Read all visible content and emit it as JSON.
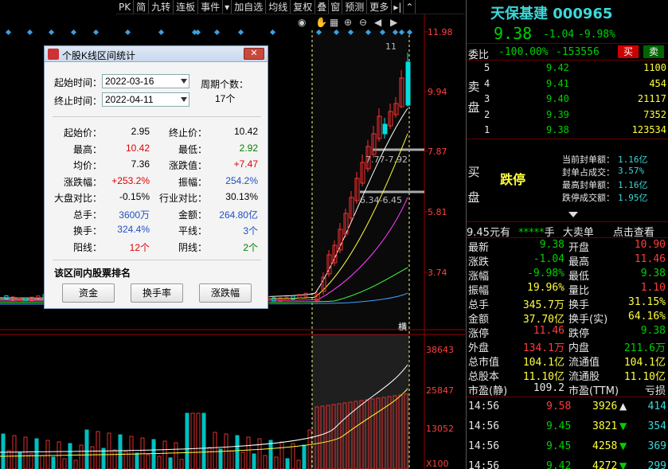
{
  "toolbar": {
    "items": [
      "PK",
      "简",
      "九转",
      "连板",
      "事件",
      "▾",
      "加自选",
      "均线",
      "复权",
      "叠",
      "窗",
      "预测",
      "更多",
      "▸|",
      "⌃"
    ]
  },
  "chart": {
    "price_axis": [
      "11.98",
      "9.94",
      "7.87",
      "5.81",
      "3.74"
    ],
    "volume_axis": [
      "38643",
      "25847",
      "13052",
      "X100"
    ],
    "annotations": [
      "11",
      "7.77-7.92",
      "6.34-6.45"
    ],
    "range_marker": "横"
  },
  "dialog": {
    "title": "个股K线区间统计",
    "start_label": "起始时间：",
    "start_value": "2022-03-16",
    "end_label": "终止时间：",
    "end_value": "2022-04-11",
    "period_label": "周期个数：",
    "period_value": "17个",
    "stats": [
      {
        "l1": "起始价：",
        "v1": "2.95",
        "c1": "",
        "l2": "终止价：",
        "v2": "10.42",
        "c2": ""
      },
      {
        "l1": "最高：",
        "v1": "10.42",
        "c1": "red",
        "l2": "最低：",
        "v2": "2.92",
        "c2": "green"
      },
      {
        "l1": "均价：",
        "v1": "7.36",
        "c1": "",
        "l2": "涨跌值：",
        "v2": "+7.47",
        "c2": "red"
      },
      {
        "l1": "涨跌幅：",
        "v1": "+253.2%",
        "c1": "red",
        "l2": "振幅：",
        "v2": "254.2%",
        "c2": "blue"
      },
      {
        "l1": "大盘对比：",
        "v1": "-0.15%",
        "c1": "",
        "l2": "行业对比：",
        "v2": "30.13%",
        "c2": ""
      },
      {
        "l1": "总手：",
        "v1": "3600万",
        "c1": "blue",
        "l2": "金额：",
        "v2": "264.80亿",
        "c2": "blue"
      },
      {
        "l1": "换手：",
        "v1": "324.4%",
        "c1": "blue",
        "l2": "平线：",
        "v2": "3个",
        "c2": "blue"
      },
      {
        "l1": "阳线：",
        "v1": "12个",
        "c1": "red",
        "l2": "阴线：",
        "v2": "2个",
        "c2": "green"
      }
    ],
    "rank_label": "该区间内股票排名",
    "buttons": [
      "资金",
      "换手率",
      "涨跌幅"
    ]
  },
  "quote": {
    "name_code": "天保基建 000965",
    "price": "9.38",
    "change": "-1.04",
    "pct": "-9.98%",
    "weibi_label": "委比",
    "weibi_pct": "-100.00%",
    "weibi_diff": "-153556",
    "buy_btn": "买",
    "sell_btn": "卖",
    "sell_label": "卖盘",
    "sells": [
      {
        "lv": "5",
        "p": "9.42",
        "v": "1100"
      },
      {
        "lv": "4",
        "p": "9.41",
        "v": "454"
      },
      {
        "lv": "3",
        "p": "9.40",
        "v": "21117"
      },
      {
        "lv": "2",
        "p": "9.39",
        "v": "7352"
      },
      {
        "lv": "1",
        "p": "9.38",
        "v": "123534"
      }
    ],
    "buy_label": "买盘",
    "limit_text": "跌停",
    "seal_rows": [
      {
        "k": "当前封单额：",
        "v": "1.16亿"
      },
      {
        "k": "封单占成交：",
        "v": "3.57%"
      },
      {
        "k": "最高封单额：",
        "v": "1.16亿"
      },
      {
        "k": "跌停成交额：",
        "v": "1.95亿"
      }
    ],
    "bar_price": "9.45",
    "bar_unit": "元有",
    "bar_stars": "*****",
    "bar_hand": "手",
    "bar_big": "大卖单",
    "bar_click": "点击查看",
    "details": [
      {
        "k1": "最新",
        "v1": "9.38",
        "c1": "G",
        "k2": "开盘",
        "v2": "10.90",
        "c2": "R"
      },
      {
        "k1": "涨跌",
        "v1": "-1.04",
        "c1": "G",
        "k2": "最高",
        "v2": "11.46",
        "c2": "R"
      },
      {
        "k1": "涨幅",
        "v1": "-9.98%",
        "c1": "G",
        "k2": "最低",
        "v2": "9.38",
        "c2": "G"
      },
      {
        "k1": "振幅",
        "v1": "19.96%",
        "c1": "Y",
        "k2": "量比",
        "v2": "1.10",
        "c2": "R"
      },
      {
        "k1": "总手",
        "v1": "345.7万",
        "c1": "Y",
        "k2": "换手",
        "v2": "31.15%",
        "c2": "Y"
      },
      {
        "k1": "金额",
        "v1": "37.70亿",
        "c1": "Y",
        "k2": "换手(实)",
        "v2": "64.16%",
        "c2": "Y"
      },
      {
        "k1": "涨停",
        "v1": "11.46",
        "c1": "R",
        "k2": "跌停",
        "v2": "9.38",
        "c2": "G"
      },
      {
        "k1": "外盘",
        "v1": "134.1万",
        "c1": "R",
        "k2": "内盘",
        "v2": "211.6万",
        "c2": "G"
      },
      {
        "k1": "总市值",
        "v1": "104.1亿",
        "c1": "Y",
        "k2": "流通值",
        "v2": "104.1亿",
        "c2": "Y"
      },
      {
        "k1": "总股本",
        "v1": "11.10亿",
        "c1": "Y",
        "k2": "流通股",
        "v2": "11.10亿",
        "c2": "Y"
      },
      {
        "k1": "市盈(静)",
        "v1": "109.2",
        "c1": "W",
        "k2": "市盈(TTM)",
        "v2": "亏损",
        "c2": "W"
      }
    ],
    "ticks": [
      {
        "t": "14:56",
        "p": "9.58",
        "v": "3926",
        "arrow": "up",
        "n": "414"
      },
      {
        "t": "14:56",
        "p": "9.45",
        "v": "3821",
        "arrow": "down",
        "n": "354"
      },
      {
        "t": "14:56",
        "p": "9.45",
        "v": "4258",
        "arrow": "down",
        "n": "369"
      },
      {
        "t": "14:56",
        "p": "9.42",
        "v": "4272",
        "arrow": "down",
        "n": "299"
      }
    ]
  }
}
